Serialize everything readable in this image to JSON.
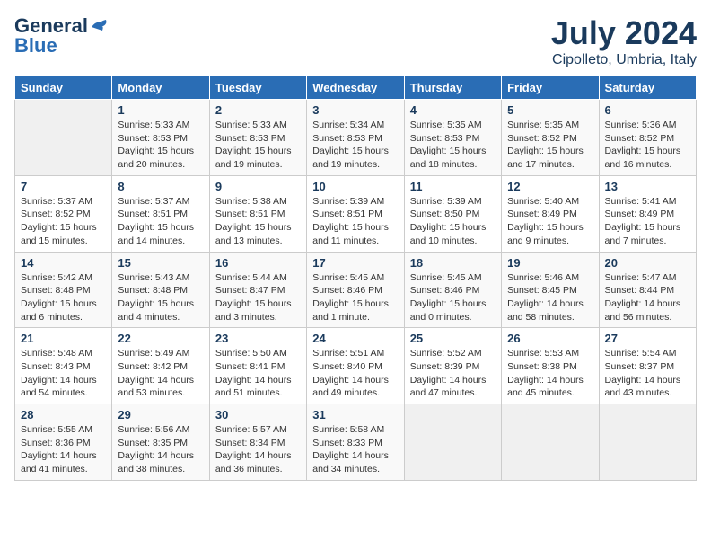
{
  "logo": {
    "line1": "General",
    "line2": "Blue"
  },
  "title": "July 2024",
  "subtitle": "Cipolleto, Umbria, Italy",
  "weekdays": [
    "Sunday",
    "Monday",
    "Tuesday",
    "Wednesday",
    "Thursday",
    "Friday",
    "Saturday"
  ],
  "weeks": [
    [
      {
        "day": "",
        "info": ""
      },
      {
        "day": "1",
        "info": "Sunrise: 5:33 AM\nSunset: 8:53 PM\nDaylight: 15 hours\nand 20 minutes."
      },
      {
        "day": "2",
        "info": "Sunrise: 5:33 AM\nSunset: 8:53 PM\nDaylight: 15 hours\nand 19 minutes."
      },
      {
        "day": "3",
        "info": "Sunrise: 5:34 AM\nSunset: 8:53 PM\nDaylight: 15 hours\nand 19 minutes."
      },
      {
        "day": "4",
        "info": "Sunrise: 5:35 AM\nSunset: 8:53 PM\nDaylight: 15 hours\nand 18 minutes."
      },
      {
        "day": "5",
        "info": "Sunrise: 5:35 AM\nSunset: 8:52 PM\nDaylight: 15 hours\nand 17 minutes."
      },
      {
        "day": "6",
        "info": "Sunrise: 5:36 AM\nSunset: 8:52 PM\nDaylight: 15 hours\nand 16 minutes."
      }
    ],
    [
      {
        "day": "7",
        "info": "Sunrise: 5:37 AM\nSunset: 8:52 PM\nDaylight: 15 hours\nand 15 minutes."
      },
      {
        "day": "8",
        "info": "Sunrise: 5:37 AM\nSunset: 8:51 PM\nDaylight: 15 hours\nand 14 minutes."
      },
      {
        "day": "9",
        "info": "Sunrise: 5:38 AM\nSunset: 8:51 PM\nDaylight: 15 hours\nand 13 minutes."
      },
      {
        "day": "10",
        "info": "Sunrise: 5:39 AM\nSunset: 8:51 PM\nDaylight: 15 hours\nand 11 minutes."
      },
      {
        "day": "11",
        "info": "Sunrise: 5:39 AM\nSunset: 8:50 PM\nDaylight: 15 hours\nand 10 minutes."
      },
      {
        "day": "12",
        "info": "Sunrise: 5:40 AM\nSunset: 8:49 PM\nDaylight: 15 hours\nand 9 minutes."
      },
      {
        "day": "13",
        "info": "Sunrise: 5:41 AM\nSunset: 8:49 PM\nDaylight: 15 hours\nand 7 minutes."
      }
    ],
    [
      {
        "day": "14",
        "info": "Sunrise: 5:42 AM\nSunset: 8:48 PM\nDaylight: 15 hours\nand 6 minutes."
      },
      {
        "day": "15",
        "info": "Sunrise: 5:43 AM\nSunset: 8:48 PM\nDaylight: 15 hours\nand 4 minutes."
      },
      {
        "day": "16",
        "info": "Sunrise: 5:44 AM\nSunset: 8:47 PM\nDaylight: 15 hours\nand 3 minutes."
      },
      {
        "day": "17",
        "info": "Sunrise: 5:45 AM\nSunset: 8:46 PM\nDaylight: 15 hours\nand 1 minute."
      },
      {
        "day": "18",
        "info": "Sunrise: 5:45 AM\nSunset: 8:46 PM\nDaylight: 15 hours\nand 0 minutes."
      },
      {
        "day": "19",
        "info": "Sunrise: 5:46 AM\nSunset: 8:45 PM\nDaylight: 14 hours\nand 58 minutes."
      },
      {
        "day": "20",
        "info": "Sunrise: 5:47 AM\nSunset: 8:44 PM\nDaylight: 14 hours\nand 56 minutes."
      }
    ],
    [
      {
        "day": "21",
        "info": "Sunrise: 5:48 AM\nSunset: 8:43 PM\nDaylight: 14 hours\nand 54 minutes."
      },
      {
        "day": "22",
        "info": "Sunrise: 5:49 AM\nSunset: 8:42 PM\nDaylight: 14 hours\nand 53 minutes."
      },
      {
        "day": "23",
        "info": "Sunrise: 5:50 AM\nSunset: 8:41 PM\nDaylight: 14 hours\nand 51 minutes."
      },
      {
        "day": "24",
        "info": "Sunrise: 5:51 AM\nSunset: 8:40 PM\nDaylight: 14 hours\nand 49 minutes."
      },
      {
        "day": "25",
        "info": "Sunrise: 5:52 AM\nSunset: 8:39 PM\nDaylight: 14 hours\nand 47 minutes."
      },
      {
        "day": "26",
        "info": "Sunrise: 5:53 AM\nSunset: 8:38 PM\nDaylight: 14 hours\nand 45 minutes."
      },
      {
        "day": "27",
        "info": "Sunrise: 5:54 AM\nSunset: 8:37 PM\nDaylight: 14 hours\nand 43 minutes."
      }
    ],
    [
      {
        "day": "28",
        "info": "Sunrise: 5:55 AM\nSunset: 8:36 PM\nDaylight: 14 hours\nand 41 minutes."
      },
      {
        "day": "29",
        "info": "Sunrise: 5:56 AM\nSunset: 8:35 PM\nDaylight: 14 hours\nand 38 minutes."
      },
      {
        "day": "30",
        "info": "Sunrise: 5:57 AM\nSunset: 8:34 PM\nDaylight: 14 hours\nand 36 minutes."
      },
      {
        "day": "31",
        "info": "Sunrise: 5:58 AM\nSunset: 8:33 PM\nDaylight: 14 hours\nand 34 minutes."
      },
      {
        "day": "",
        "info": ""
      },
      {
        "day": "",
        "info": ""
      },
      {
        "day": "",
        "info": ""
      }
    ]
  ]
}
